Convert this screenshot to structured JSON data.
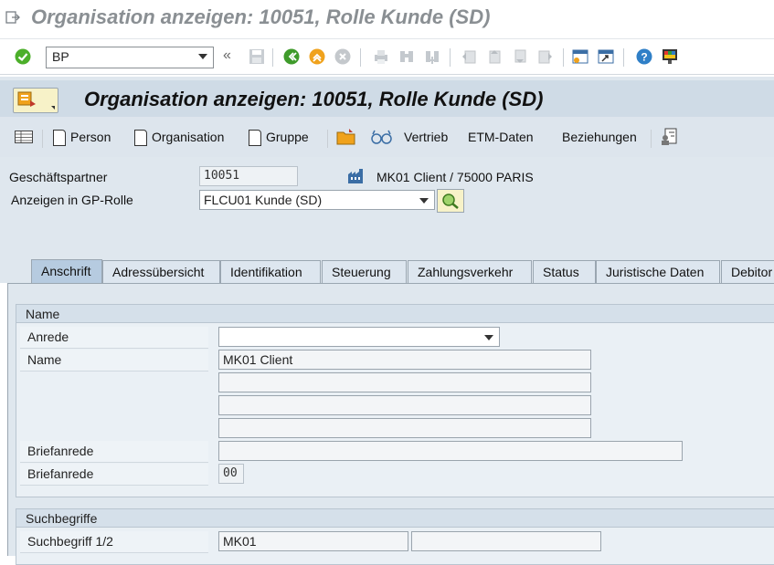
{
  "window": {
    "title": "Organisation anzeigen: 10051, Rolle Kunde (SD)"
  },
  "toolbar": {
    "command_value": "BP"
  },
  "header": {
    "title": "Organisation anzeigen: 10051, Rolle Kunde (SD)"
  },
  "app_toolbar": {
    "person": "Person",
    "organisation": "Organisation",
    "gruppe": "Gruppe",
    "vertrieb": "Vertrieb",
    "etm": "ETM-Daten",
    "beziehungen": "Beziehungen"
  },
  "form": {
    "partner_label": "Geschäftspartner",
    "partner_value": "10051",
    "partner_desc": "MK01 Client / 75000 PARIS",
    "role_label": "Anzeigen in GP-Rolle",
    "role_value": "FLCU01 Kunde (SD)"
  },
  "tabs": [
    "Anschrift",
    "Adressübersicht",
    "Identifikation",
    "Steuerung",
    "Zahlungsverkehr",
    "Status",
    "Juristische Daten",
    "Debitor"
  ],
  "name_group": {
    "title": "Name",
    "anrede_label": "Anrede",
    "anrede_value": "",
    "name_label": "Name",
    "name1": "MK01 Client",
    "name2": "",
    "name3": "",
    "name4": "",
    "brief_label": "Briefanrede",
    "brief_value": "",
    "brief2_label": "Briefanrede",
    "brief2_value": "00"
  },
  "search_group": {
    "title": "Suchbegriffe",
    "label": "Suchbegriff 1/2",
    "value1": "MK01",
    "value2": ""
  }
}
